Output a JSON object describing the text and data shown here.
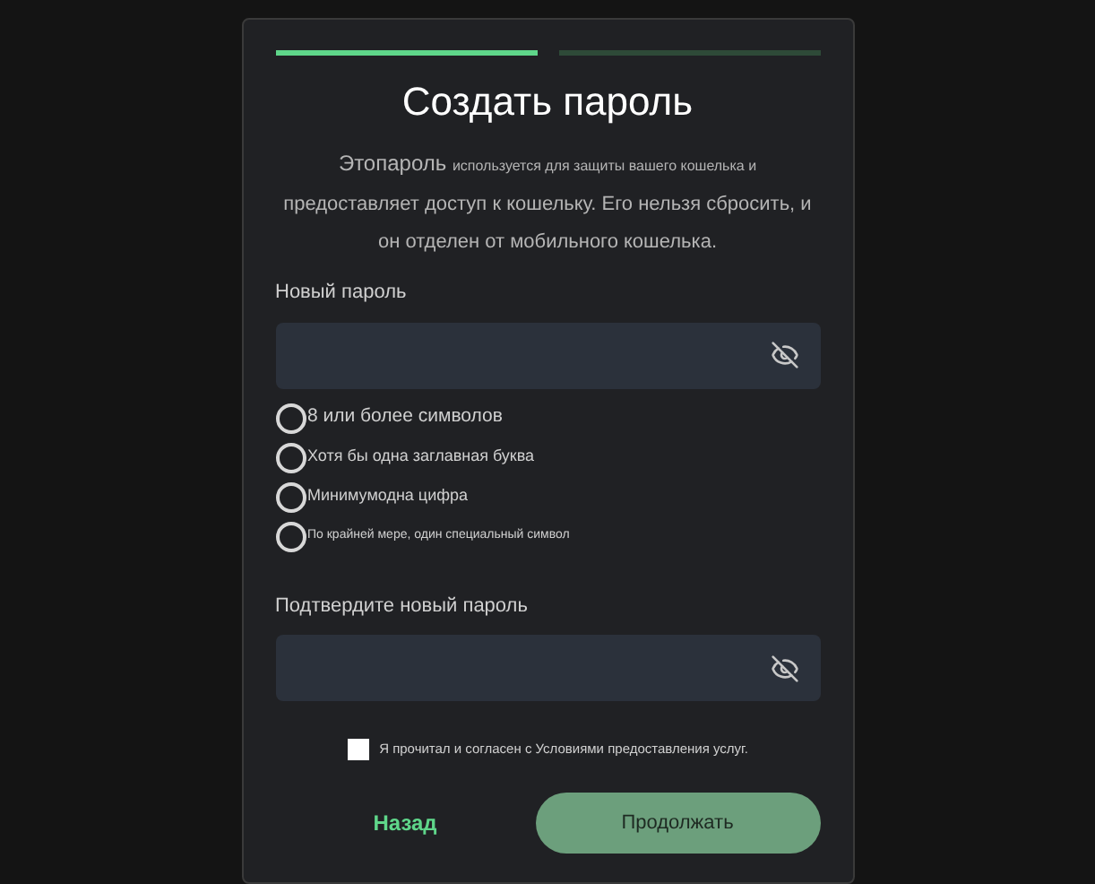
{
  "steps": [
    {
      "active": true
    },
    {
      "active": false
    }
  ],
  "title": "Создать пароль",
  "description": [
    {
      "text": "Этопароль",
      "kind": "large"
    },
    {
      "text": "используется для защиты вашего кошелька и",
      "kind": "small"
    },
    {
      "text": "предоставляет доступ к кошельку. Его нельзя сбросить, и он отделен от мобильного кошелька.",
      "kind": "normal"
    }
  ],
  "new_password": {
    "label": "Новый пароль"
  },
  "requirements": [
    {
      "text": "8 или более символов",
      "kind": "normal",
      "met": false
    },
    {
      "text": "Хотя бы одна заглавная буква",
      "kind": "small",
      "met": false
    },
    {
      "text": "Минимумодна цифра",
      "kind": "small",
      "met": false
    },
    {
      "text": "По крайней мере, один специальный символ",
      "kind": "tiny",
      "met": false
    }
  ],
  "confirm_password": {
    "label": "Подтвердите новый пароль"
  },
  "terms": {
    "text": "Я прочитал и согласен с Условиями предоставления услуг.",
    "checked": false
  },
  "back_button": "Назад",
  "continue_button": "Продолжать"
}
